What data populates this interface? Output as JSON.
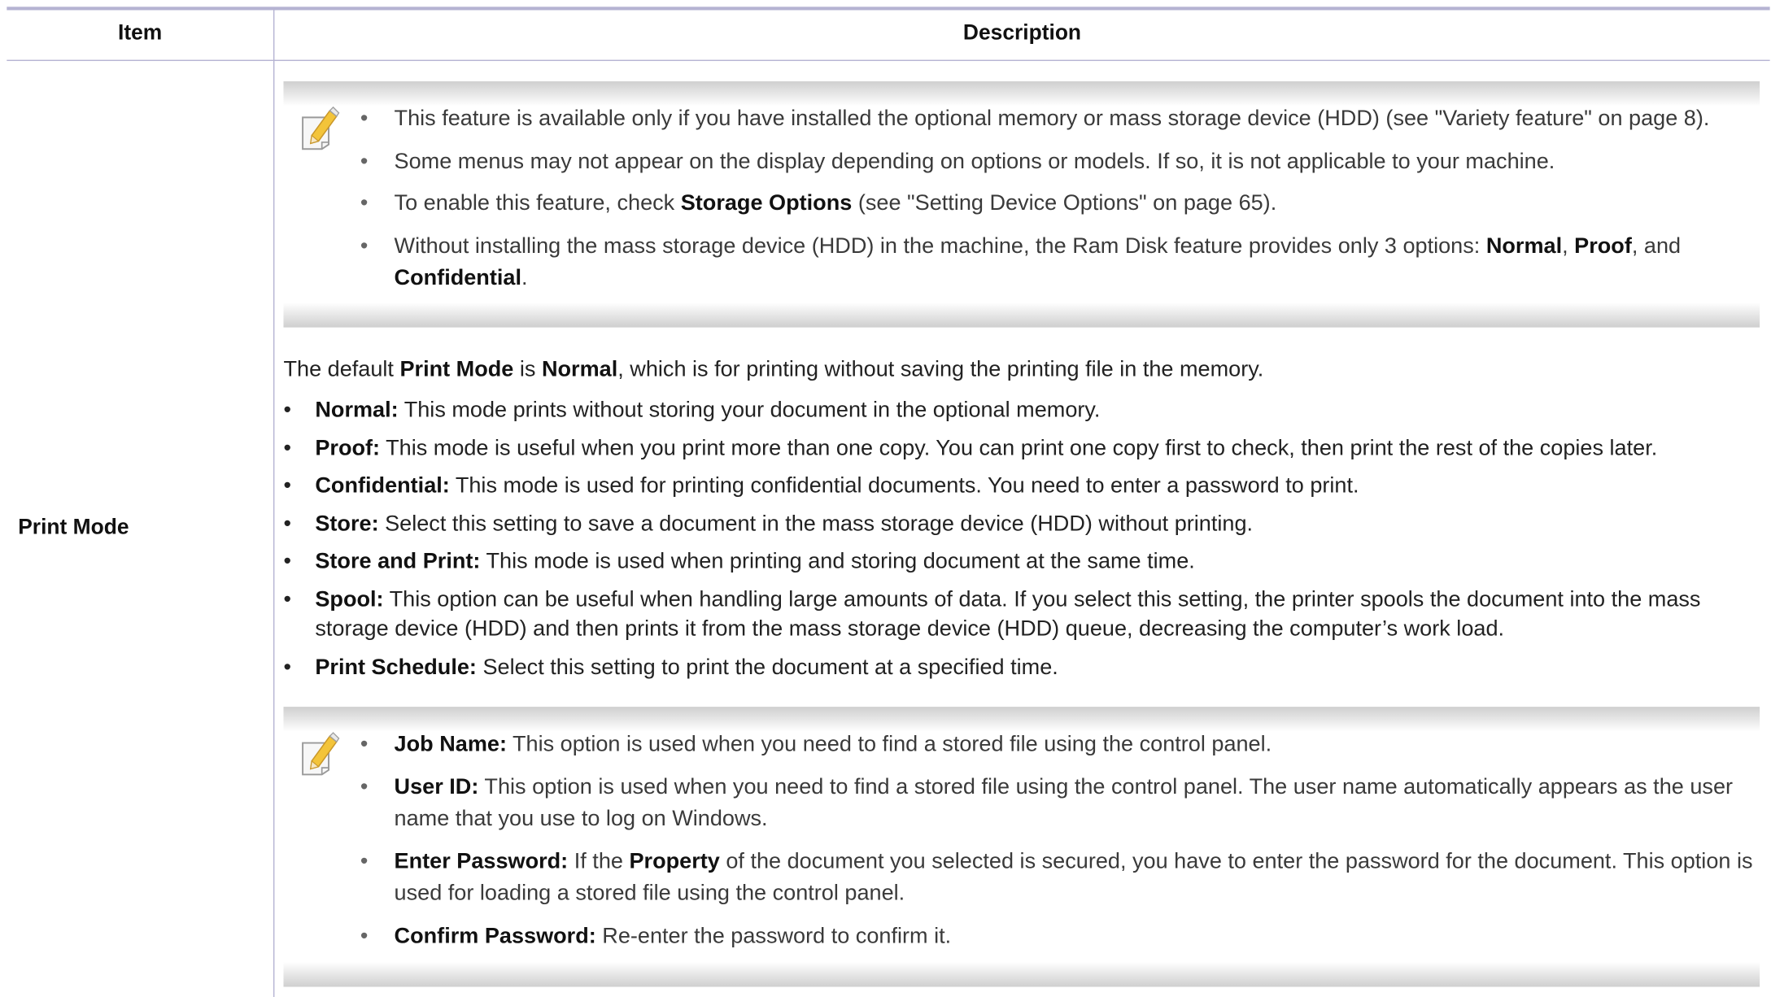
{
  "header": {
    "item": "Item",
    "description": "Description"
  },
  "row": {
    "item_label": "Print Mode"
  },
  "note_top": {
    "icon": "note-pencil-icon",
    "bullets": [
      {
        "parts": [
          {
            "t": " This feature is available only if you have installed the optional memory or mass storage device (HDD) (see \"Variety feature\" on page 8).",
            "b": false
          }
        ]
      },
      {
        "parts": [
          {
            "t": "Some menus may not appear on the display depending on options or models. If so, it is not applicable to your machine.",
            "b": false
          }
        ]
      },
      {
        "parts": [
          {
            "t": "To enable this feature, check ",
            "b": false
          },
          {
            "t": "Storage Options",
            "b": true
          },
          {
            "t": " (see \"Setting Device Options\" on page 65).",
            "b": false
          }
        ]
      },
      {
        "parts": [
          {
            "t": "Without installing the mass storage device (HDD) in the machine, the Ram Disk feature provides only 3 options: ",
            "b": false
          },
          {
            "t": "Normal",
            "b": true
          },
          {
            "t": ", ",
            "b": false
          },
          {
            "t": "Proof",
            "b": true
          },
          {
            "t": ", and ",
            "b": false
          },
          {
            "t": "Confidential",
            "b": true
          },
          {
            "t": ".",
            "b": false
          }
        ]
      }
    ]
  },
  "intro": [
    {
      "t": "The default ",
      "b": false
    },
    {
      "t": "Print Mode",
      "b": true
    },
    {
      "t": " is ",
      "b": false
    },
    {
      "t": "Normal",
      "b": true
    },
    {
      "t": ", which is for printing without saving the printing file in the memory.",
      "b": false
    }
  ],
  "modes": [
    {
      "term": "Normal:",
      "text": " This mode prints without storing your document in the optional memory."
    },
    {
      "term": "Proof:",
      "text": " This mode is useful when you print more than one copy. You can print one copy first to check, then print the rest of the copies later."
    },
    {
      "term": "Confidential:",
      "text": " This mode is used for printing confidential documents. You need to enter a password to print."
    },
    {
      "term": "Store:",
      "text": " Select this setting to save a document in the mass storage device (HDD) without printing."
    },
    {
      "term": "Store and Print:",
      "text": " This mode is used when printing and storing document at the same time."
    },
    {
      "term": "Spool:",
      "text": " This option can be useful when handling large amounts of data. If you select this setting, the printer spools the document into the mass storage device (HDD) and then prints it from the mass storage device (HDD) queue, decreasing the computer’s work load."
    },
    {
      "term": "Print Schedule:",
      "text": " Select this setting to print the document at a specified time."
    }
  ],
  "note_bottom": {
    "icon": "note-pencil-icon",
    "bullets": [
      {
        "parts": [
          {
            "t": "Job Name:",
            "b": true
          },
          {
            "t": " This option is used when you need to find a stored file using the control panel.",
            "b": false
          }
        ]
      },
      {
        "parts": [
          {
            "t": "User ID:",
            "b": true
          },
          {
            "t": " This option is used when you need to find a stored file using the control panel. The user name automatically appears as the user name that you use to log on Windows.",
            "b": false
          }
        ]
      },
      {
        "parts": [
          {
            "t": "Enter Password:",
            "b": true
          },
          {
            "t": " If the ",
            "b": false
          },
          {
            "t": "Property",
            "b": true
          },
          {
            "t": " of the document you selected is secured, you have to enter the password for the document.  This option is used for loading a stored file using the control panel.",
            "b": false
          }
        ]
      },
      {
        "parts": [
          {
            "t": "Confirm Password:",
            "b": true
          },
          {
            "t": " Re-enter the password to confirm it.",
            "b": false
          }
        ]
      }
    ]
  },
  "bullet_char": "•"
}
